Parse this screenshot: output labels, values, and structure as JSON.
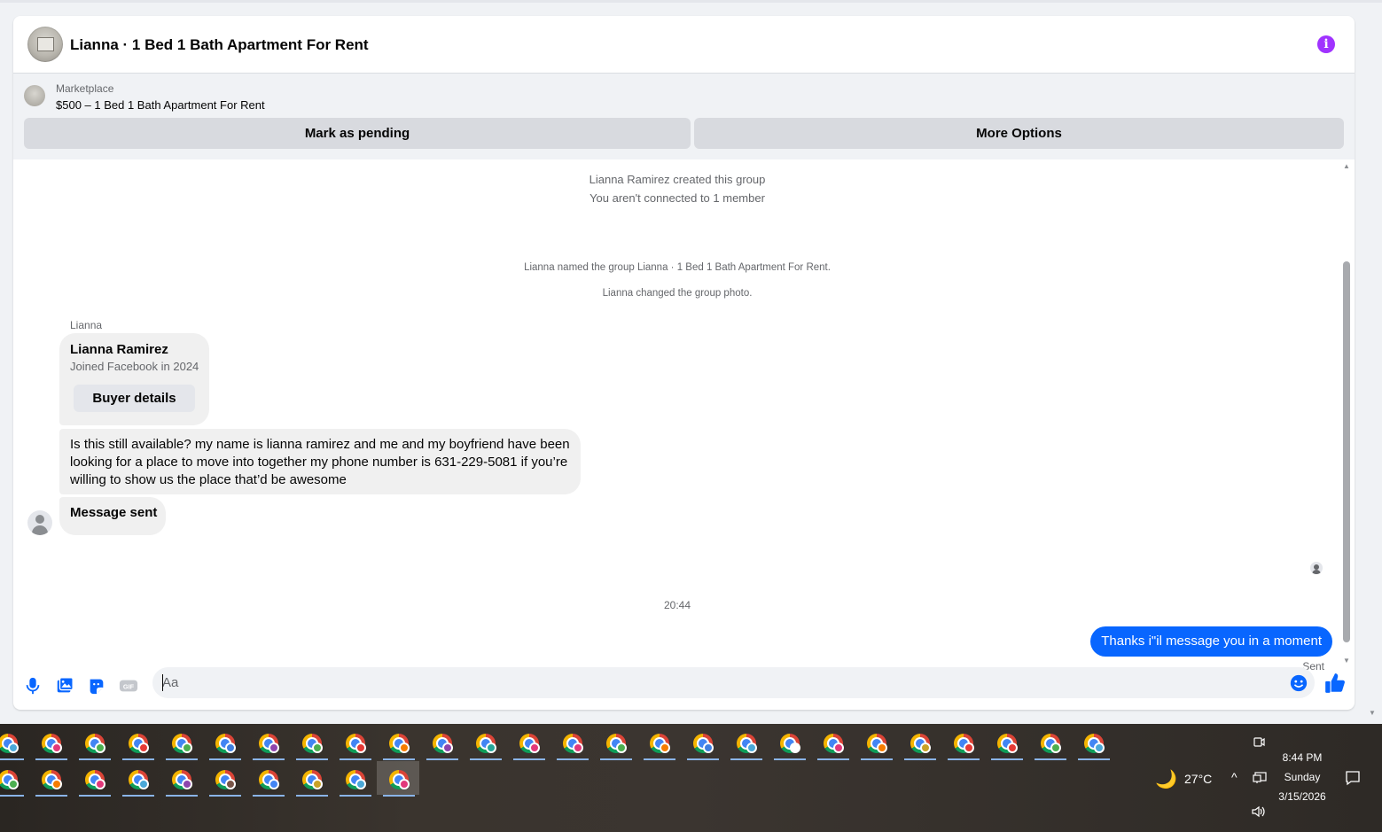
{
  "chat": {
    "title": "Lianna · 1 Bed 1 Bath Apartment For Rent",
    "info_icon": "info-icon"
  },
  "marketplace": {
    "label": "Marketplace",
    "item": "$500 – 1 Bed 1 Bath Apartment For Rent",
    "mark_pending": "Mark as pending",
    "more_options": "More Options"
  },
  "messages": {
    "system": [
      "Lianna Ramirez created this group",
      "You aren't connected to 1 member",
      "Lianna named the group Lianna · 1 Bed 1 Bath Apartment For Rent.",
      "Lianna changed the group photo."
    ],
    "sender": "Lianna",
    "card": {
      "name": "Lianna Ramirez",
      "joined": "Joined Facebook in 2024",
      "button": "Buyer details"
    },
    "incoming_text": "Is this still available? my name is lianna ramirez and me and my boyfriend have been looking for a place to move into together my phone number is 631-229-5081 if you’re willing to show us the place that’d be awesome",
    "incoming_status": "Message sent",
    "time": "20:44",
    "outgoing_text": "Thanks i\"il message you in a moment",
    "outgoing_status": "Sent"
  },
  "composer": {
    "placeholder": "Aa",
    "icons": [
      "microphone-icon",
      "photo-icon",
      "sticker-icon",
      "gif-icon",
      "emoji-icon",
      "like-icon"
    ],
    "gif_label": "GIF"
  },
  "taskbar": {
    "weather_temp": "27°C",
    "time": "8:44 PM",
    "day": "Sunday",
    "date": "3/15/2026",
    "row1_badge_colors": [
      "#4aa8d8",
      "#e2387a",
      "#4caf50",
      "#e53935",
      "#4caf50",
      "#3f7fe0",
      "#8e44ad",
      "#4caf50",
      "#e53935",
      "#f57c00",
      "#8e44ad",
      "#26a69a",
      "#e2387a",
      "#e2387a",
      "#4caf50",
      "#f57c00",
      "#3f7fe0",
      "#4aa8d8",
      "#ffffff",
      "#e2387a",
      "#f57c00",
      "#c9a227",
      "#e53935",
      "#e53935",
      "#4caf50",
      "#4aa8d8"
    ],
    "row2_badge_colors": [
      "#4caf50",
      "#f57c00",
      "#e2387a",
      "#4aa8d8",
      "#8e44ad",
      "#795548",
      "#4285f4",
      "#c9a227",
      "#4aa8d8",
      "#e2387a"
    ]
  },
  "colors": {
    "accent": "#0866ff",
    "info": "#a033ff"
  }
}
